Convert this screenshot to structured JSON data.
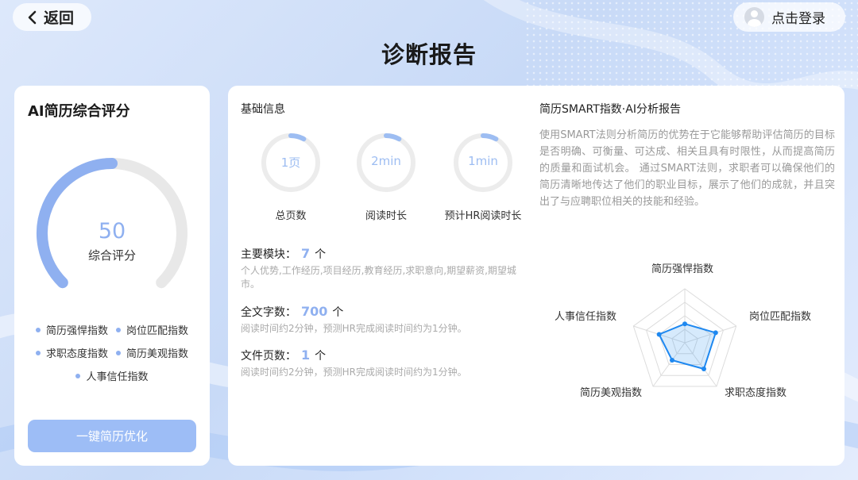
{
  "header": {
    "back_label": "返回",
    "login_label": "点击登录",
    "page_title": "诊断报告"
  },
  "score_card": {
    "title": "AI简历综合评分",
    "score": "50",
    "score_label": "综合评分",
    "score_fraction": 0.5,
    "legend": [
      {
        "label": "简历强悍指数"
      },
      {
        "label": "岗位匹配指数"
      },
      {
        "label": "求职态度指数"
      },
      {
        "label": "简历美观指数"
      },
      {
        "label": "人事信任指数"
      }
    ],
    "optimize_label": "一键简历优化",
    "colors": {
      "accent": "#8fb0f0",
      "track": "#e8e8e8",
      "button": "#9dbdf6"
    }
  },
  "basic_info": {
    "title": "基础信息",
    "rings": [
      {
        "value": "1页",
        "label": "总页数",
        "fraction": 0.08
      },
      {
        "value": "2min",
        "label": "阅读时长",
        "fraction": 0.08
      },
      {
        "value": "1min",
        "label": "预计HR阅读时长",
        "fraction": 0.08
      }
    ],
    "modules": {
      "label": "主要模块：",
      "count": "7",
      "unit": "个",
      "desc": "个人优势,工作经历,项目经历,教育经历,求职意向,期望薪资,期望城市。"
    },
    "word_count": {
      "label": "全文字数：",
      "count": "700",
      "unit": "个",
      "desc": "阅读时间约2分钟，预测HR完成阅读时间约为1分钟。"
    },
    "page_count": {
      "label": "文件页数：",
      "count": "1",
      "unit": "个",
      "desc": "阅读时间约2分钟，预测HR完成阅读时间约为1分钟。"
    }
  },
  "smart_report": {
    "title": "简历SMART指数·AI分析报告",
    "text": "使用SMART法则分析简历的优势在于它能够帮助评估简历的目标是否明确、可衡量、可达成、相关且具有时限性，从而提高简历的质量和面试机会。 通过SMART法则，求职者可以确保他们的简历清晰地传达了他们的职业目标，展示了他们的成就，并且突出了与应聘职位相关的技能和经验。",
    "radar": {
      "axes": [
        "简历强悍指数",
        "岗位匹配指数",
        "求职态度指数",
        "简历美观指数",
        "人事信任指数"
      ],
      "values": [
        0.35,
        0.6,
        0.6,
        0.4,
        0.5
      ],
      "color": "#1e88f0"
    }
  }
}
